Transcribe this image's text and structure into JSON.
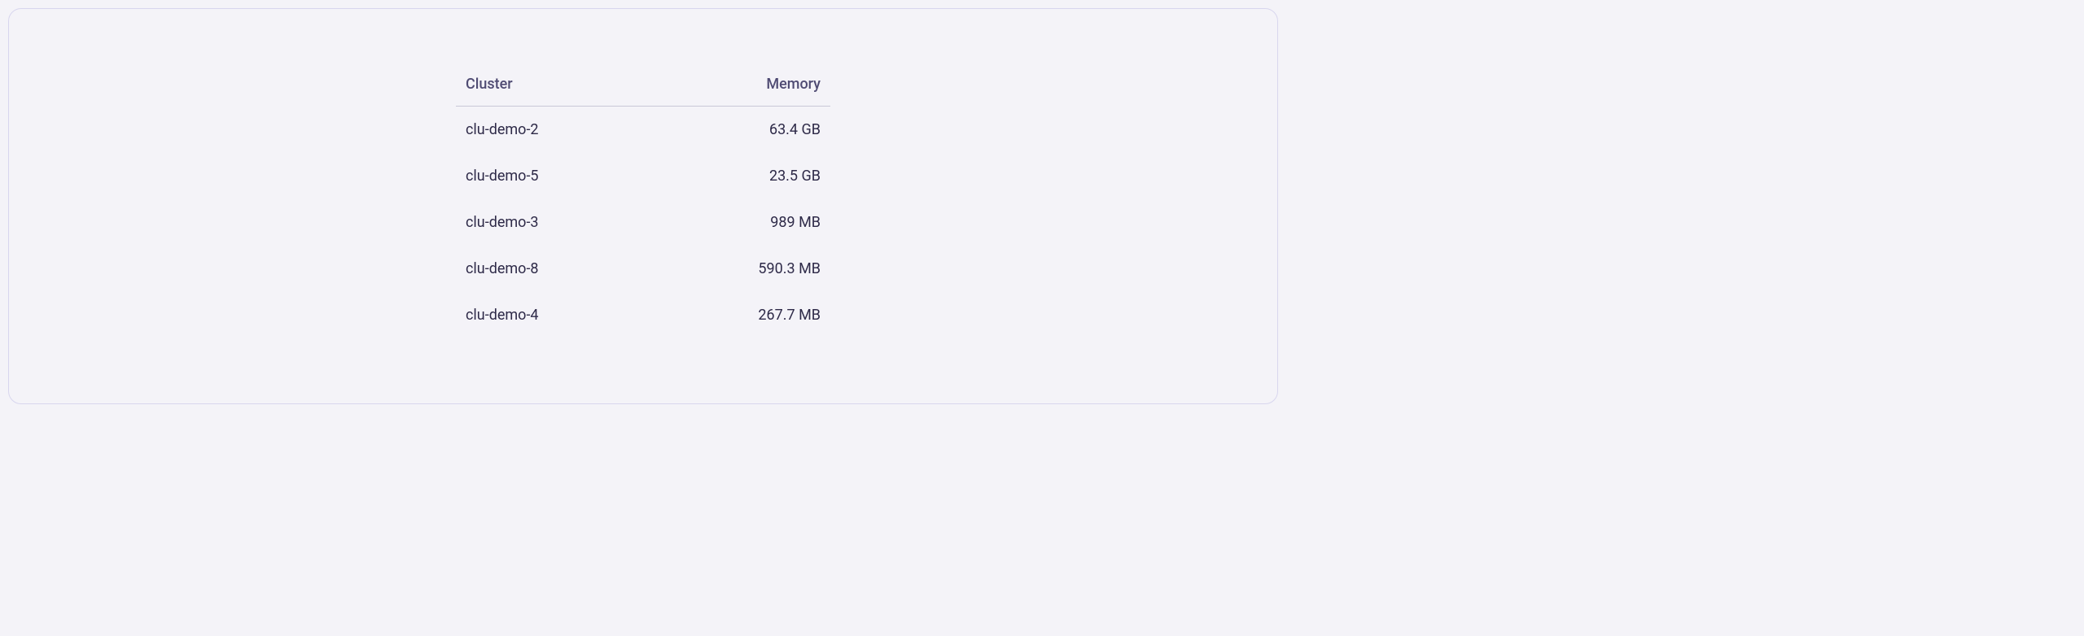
{
  "table": {
    "headers": {
      "cluster": "Cluster",
      "memory": "Memory"
    },
    "rows": [
      {
        "cluster": "clu-demo-2",
        "memory": "63.4 GB"
      },
      {
        "cluster": "clu-demo-5",
        "memory": "23.5 GB"
      },
      {
        "cluster": "clu-demo-3",
        "memory": "989 MB"
      },
      {
        "cluster": "clu-demo-8",
        "memory": "590.3 MB"
      },
      {
        "cluster": "clu-demo-4",
        "memory": "267.7 MB"
      }
    ]
  }
}
